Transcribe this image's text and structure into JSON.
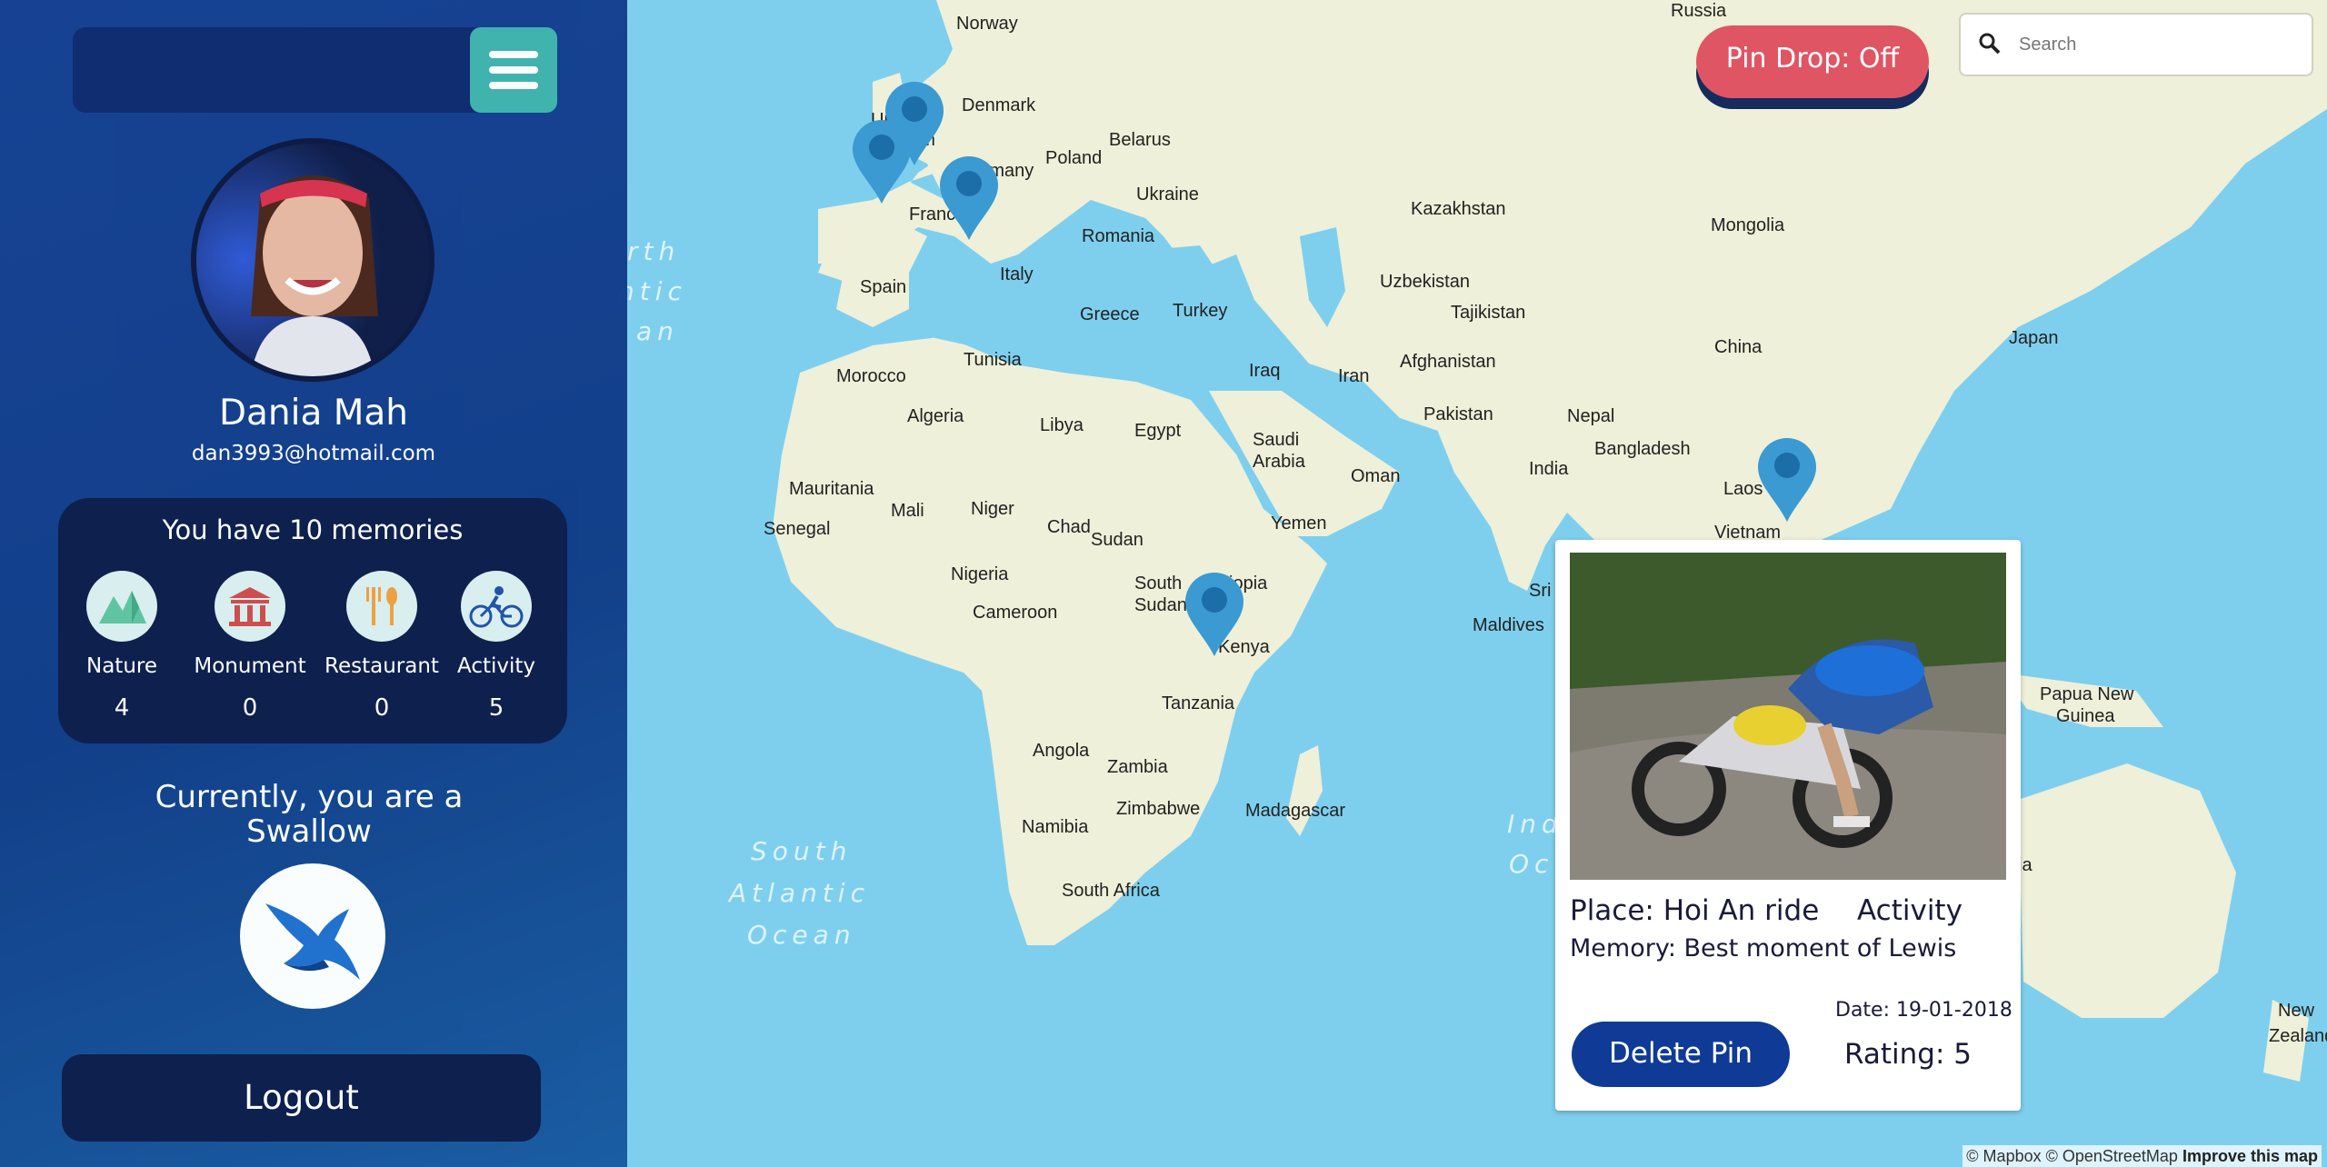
{
  "map": {
    "ocean_color": "#7ecfee",
    "land_color": "#eef0d9",
    "attribution": "© Mapbox © OpenStreetMap",
    "improve_link": "Improve this map",
    "labels": [
      {
        "text": "Russia"
      },
      {
        "text": "Norway"
      },
      {
        "text": "Denmark"
      },
      {
        "text": "United"
      },
      {
        "text": "Kingdom"
      },
      {
        "text": "Germany"
      },
      {
        "text": "Poland"
      },
      {
        "text": "Belarus"
      },
      {
        "text": "Ukraine"
      },
      {
        "text": "France"
      },
      {
        "text": "Romania"
      },
      {
        "text": "Italy"
      },
      {
        "text": "Spain"
      },
      {
        "text": "Greece"
      },
      {
        "text": "Turkey"
      },
      {
        "text": "Kazakhstan"
      },
      {
        "text": "Mongolia"
      },
      {
        "text": "Uzbekistan"
      },
      {
        "text": "Tajikistan"
      },
      {
        "text": "Afghanistan"
      },
      {
        "text": "Iraq"
      },
      {
        "text": "Iran"
      },
      {
        "text": "China"
      },
      {
        "text": "Japan"
      },
      {
        "text": "Pakistan"
      },
      {
        "text": "Nepal"
      },
      {
        "text": "Bangladesh"
      },
      {
        "text": "India"
      },
      {
        "text": "Laos"
      },
      {
        "text": "Vietnam"
      },
      {
        "text": "Tunisia"
      },
      {
        "text": "Morocco"
      },
      {
        "text": "Algeria"
      },
      {
        "text": "Libya"
      },
      {
        "text": "Egypt"
      },
      {
        "text": "Saudi"
      },
      {
        "text": "Arabia"
      },
      {
        "text": "Oman"
      },
      {
        "text": "Yemen"
      },
      {
        "text": "Mauritania"
      },
      {
        "text": "Mali"
      },
      {
        "text": "Niger"
      },
      {
        "text": "Chad"
      },
      {
        "text": "Sudan"
      },
      {
        "text": "Senegal"
      },
      {
        "text": "Nigeria"
      },
      {
        "text": "South"
      },
      {
        "text": "Sudan"
      },
      {
        "text": "Ethiopia"
      },
      {
        "text": "Cameroon"
      },
      {
        "text": "Kenya"
      },
      {
        "text": "Tanzania"
      },
      {
        "text": "Angola"
      },
      {
        "text": "Zambia"
      },
      {
        "text": "Zimbabwe"
      },
      {
        "text": "Madagascar"
      },
      {
        "text": "Namibia"
      },
      {
        "text": "South Africa"
      },
      {
        "text": "Sri"
      },
      {
        "text": "Maldives"
      },
      {
        "text": "Papua New"
      },
      {
        "text": "Guinea"
      },
      {
        "text": "New"
      },
      {
        "text": "Zealand"
      },
      {
        "text": "ia"
      }
    ],
    "ocean_labels": [
      {
        "text": "South"
      },
      {
        "text": "Atlantic"
      },
      {
        "text": "Ocean"
      },
      {
        "text": "rth"
      },
      {
        "text": "ntic"
      },
      {
        "text": "an"
      },
      {
        "text": "Ind"
      },
      {
        "text": "Oc"
      }
    ],
    "pins": [
      {
        "name": "uk-1"
      },
      {
        "name": "uk-2"
      },
      {
        "name": "germany"
      },
      {
        "name": "kenya"
      },
      {
        "name": "vietnam"
      }
    ]
  },
  "sidebar": {
    "profile": {
      "name": "Dania Mah",
      "email": "dan3993@hotmail.com"
    },
    "memories": {
      "title": "You have 10 memories",
      "categories": [
        {
          "label": "Nature",
          "count": "4",
          "icon": "nature-icon"
        },
        {
          "label": "Monument",
          "count": "0",
          "icon": "monument-icon"
        },
        {
          "label": "Restaurant",
          "count": "0",
          "icon": "restaurant-icon"
        },
        {
          "label": "Activity",
          "count": "5",
          "icon": "activity-icon"
        }
      ]
    },
    "status": "Currently, you are a Swallow",
    "logout": "Logout"
  },
  "toolbar": {
    "pin_drop": "Pin Drop: Off",
    "search_placeholder": "Search"
  },
  "popup": {
    "place": "Place: Hoi An ride",
    "category": "Activity",
    "memory": "Memory: Best moment of Lewis",
    "date": "Date: 19-01-2018",
    "rating": "Rating: 5",
    "delete": "Delete Pin"
  },
  "colors": {
    "accent_red": "#e05563",
    "sidebar_blue": "#143e92",
    "pin_blue": "#3a9ad1",
    "teal": "#3fb3ac",
    "dark_navy": "#0b1b48"
  }
}
